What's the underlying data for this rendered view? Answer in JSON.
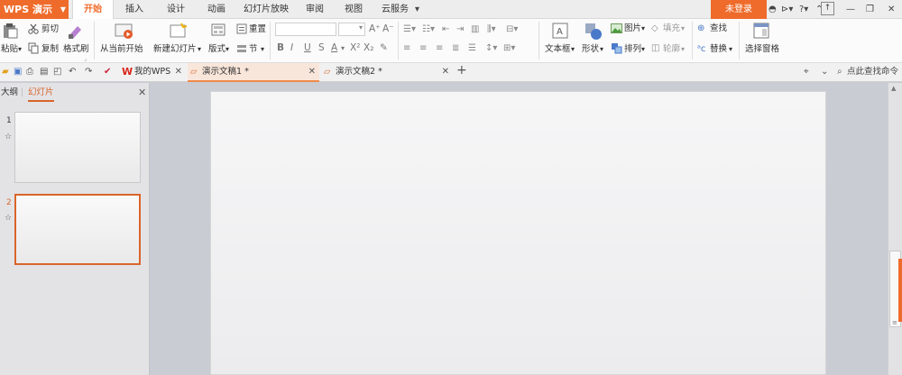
{
  "app": {
    "name": "WPS 演示",
    "login": "未登录"
  },
  "menu_tabs": [
    "开始",
    "插入",
    "设计",
    "动画",
    "幻灯片放映",
    "审阅",
    "视图",
    "云服务"
  ],
  "ribbon": {
    "paste": "粘贴",
    "cut": "剪切",
    "copy": "复制",
    "format_painter": "格式刷",
    "from_current": "从当前开始",
    "new_slide": "新建幻灯片",
    "layout": "版式",
    "reset": "重置",
    "section": "节",
    "textbox": "文本框",
    "shape": "形状",
    "picture": "图片",
    "fill": "填充",
    "arrange": "排列",
    "outline": "轮廓",
    "find": "查找",
    "replace": "替换",
    "selection_pane": "选择窗格"
  },
  "doc_tabs": {
    "home": "我的WPS",
    "doc1": "演示文稿1 *",
    "doc2": "演示文稿2 *",
    "search": "点此查找命令"
  },
  "panel": {
    "outline_tab": "大纲",
    "slides_tab": "幻灯片",
    "slides": [
      {
        "num": "1"
      },
      {
        "num": "2"
      }
    ]
  },
  "colors": {
    "accent": "#ef6b2b",
    "selected_border": "#d9652a"
  }
}
